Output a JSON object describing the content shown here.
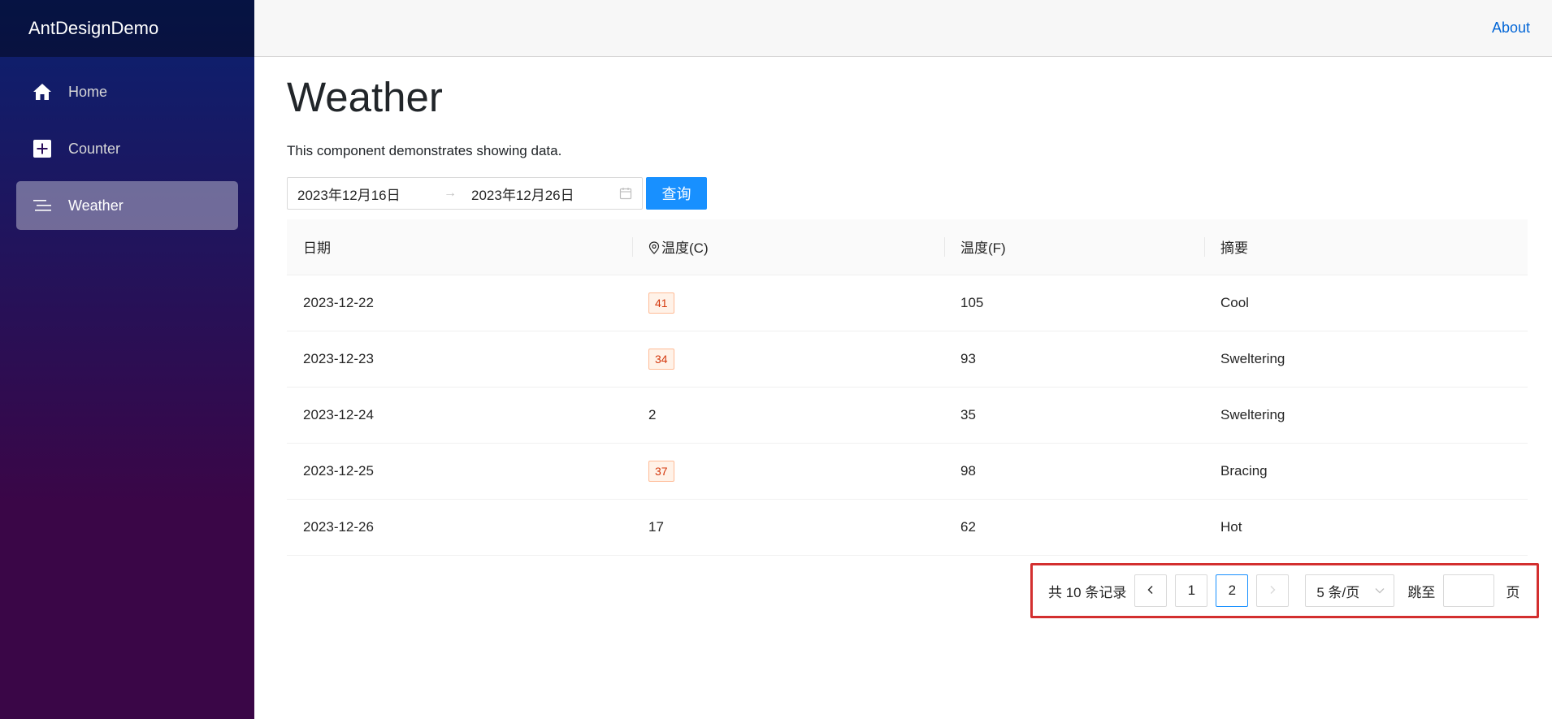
{
  "app": {
    "brand": "AntDesignDemo",
    "about": "About"
  },
  "sidebar": {
    "items": [
      {
        "label": "Home",
        "icon": "home-icon"
      },
      {
        "label": "Counter",
        "icon": "plus-square-icon"
      },
      {
        "label": "Weather",
        "icon": "list-icon",
        "active": true
      }
    ]
  },
  "page": {
    "title": "Weather",
    "description": "This component demonstrates showing data."
  },
  "filter": {
    "start_date": "2023年12月16日",
    "end_date": "2023年12月26日",
    "query_label": "查询"
  },
  "table": {
    "columns": [
      "日期",
      "温度(C)",
      "温度(F)",
      "摘要"
    ],
    "rows": [
      {
        "date": "2023-12-22",
        "temp_c": "41",
        "temp_f": "105",
        "summary": "Cool"
      },
      {
        "date": "2023-12-23",
        "temp_c": "34",
        "temp_f": "93",
        "summary": "Sweltering"
      },
      {
        "date": "2023-12-24",
        "temp_c": "2",
        "temp_f": "35",
        "summary": "Sweltering"
      },
      {
        "date": "2023-12-25",
        "temp_c": "37",
        "temp_f": "98",
        "summary": "Bracing"
      },
      {
        "date": "2023-12-26",
        "temp_c": "17",
        "temp_f": "62",
        "summary": "Hot"
      }
    ]
  },
  "pagination": {
    "total_text": "共 10 条记录",
    "prev": "<",
    "next": ">",
    "pages": [
      "1",
      "2"
    ],
    "current": "2",
    "page_size": "5 条/页",
    "jump_label": "跳至",
    "page_suffix": "页"
  },
  "colors": {
    "accent": "#1890ff",
    "tag_text": "#d4380d",
    "tag_bg": "#fff2e8",
    "tag_border": "#ffbb96",
    "highlight_box": "#d32f2f"
  }
}
